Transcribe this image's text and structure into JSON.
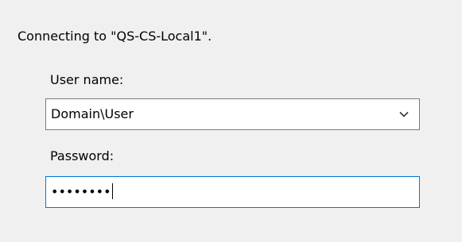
{
  "dialog": {
    "message": "Connecting to \"QS-CS-Local1\"."
  },
  "user_name": {
    "label": "User name:",
    "value": "Domain\\User",
    "dropdown_icon": "chevron-down-icon"
  },
  "password": {
    "label": "Password:",
    "masked_value": "••••••••"
  },
  "colors": {
    "window_background": "#f0f0f0",
    "field_border": "#7a7a7a",
    "focused_border": "#0078d7"
  }
}
